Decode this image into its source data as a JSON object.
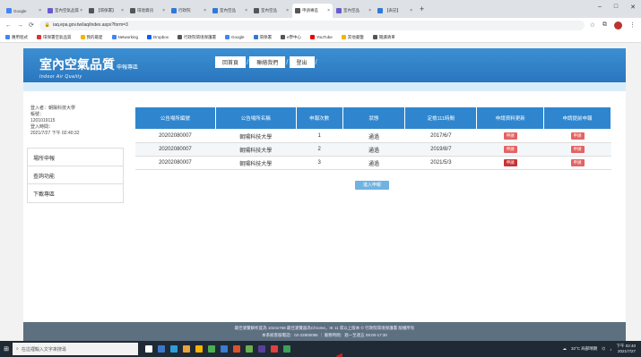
{
  "browser": {
    "tabs": [
      {
        "label": "Google",
        "color": "#4285f4",
        "active": false
      },
      {
        "label": "室內空氣品質",
        "color": "#6a5acd",
        "active": false
      },
      {
        "label": "【環保署】",
        "color": "#555555",
        "active": false
      },
      {
        "label": "環境資訊",
        "color": "#555555",
        "active": false
      },
      {
        "label": "行政院",
        "color": "#2f7ad6",
        "active": false
      },
      {
        "label": "室內空品",
        "color": "#2f7ad6",
        "active": false
      },
      {
        "label": "室內空品",
        "color": "#555555",
        "active": false
      },
      {
        "label": "申請專區",
        "color": "#555555",
        "active": true
      },
      {
        "label": "室內空品",
        "color": "#6a5acd",
        "active": false
      },
      {
        "label": "【表記】",
        "color": "#2f7ad6",
        "active": false
      }
    ],
    "new_tab": "+",
    "window_controls": [
      "–",
      "□",
      "✕"
    ],
    "url": "iaq.epa.gov.tw/iaq/index.aspx?form=3",
    "bookmarks": [
      {
        "label": "應用程式",
        "color": "#4285f4"
      },
      {
        "label": "環保署空氣品質",
        "color": "#d33"
      },
      {
        "label": "我的最愛",
        "color": "#f4b400"
      },
      {
        "label": "Networking",
        "color": "#4285f4"
      },
      {
        "label": "Dropbox",
        "color": "#0061ff"
      },
      {
        "label": "行政院環境保護署",
        "color": "#555"
      },
      {
        "label": "Google",
        "color": "#4285f4"
      },
      {
        "label": "環保署",
        "color": "#2f7ad6"
      },
      {
        "label": "e學中心",
        "color": "#555"
      },
      {
        "label": "YouTube",
        "color": "#e00"
      },
      {
        "label": "其他書籤",
        "color": "#f4b400"
      },
      {
        "label": "閱讀清單",
        "color": "#555"
      }
    ]
  },
  "site": {
    "title": "室內空氣品質",
    "title_suffix": "申報專區",
    "subtitle": "Indoor Air Quality",
    "nav": [
      "回首頁",
      "聯絡我們",
      "登出"
    ]
  },
  "sidebar": {
    "user_lines": [
      "登入者：朝陽科技大學",
      "帳號：",
      "1201019115",
      "登入時間：",
      "2021/7/27 下午 02:40:32"
    ],
    "menu": [
      "場所申報",
      "查詢功能",
      "下載專區"
    ]
  },
  "table": {
    "headers": [
      "公告場所編號",
      "公告場所名稱",
      "申報次數",
      "狀態",
      "定檢111時間",
      "申請資料更新",
      "申請提前申報"
    ],
    "rows": [
      {
        "id": "20202080007",
        "name": "朝陽科技大學",
        "count": "1",
        "status": "通過",
        "date": "2017/6/7",
        "update": "申請",
        "early": "申請"
      },
      {
        "id": "20202080007",
        "name": "朝陽科技大學",
        "count": "2",
        "status": "通過",
        "date": "2019/8/7",
        "update": "申請",
        "early": "申請"
      },
      {
        "id": "20202080007",
        "name": "朝陽科技大學",
        "count": "3",
        "status": "通過",
        "date": "2021/5/3",
        "update": "申請",
        "early": "申請"
      }
    ],
    "submit_label": "進入申報"
  },
  "footer": {
    "line1": "最佳瀏覽解析度為 1024x768 最佳瀏覽器為Chrome，IE 11 或以上版本 © 行政院環境保護署 版權所有",
    "line2": "本系統客服電話：02-22800095 ｜ 服務時間：週一至週五 09:00-17:30"
  },
  "taskbar": {
    "search_placeholder": "在這裡輸入文字來搜尋",
    "tray_temp": "32°C 局部晴朗",
    "time": "下午 02:40",
    "date": "2021/7/27",
    "app_colors": [
      "#ffffff",
      "#3c78c8",
      "#2d9cdb",
      "#e8a33d",
      "#f4b400",
      "#4caf50",
      "#3a7bd5",
      "#d9532c",
      "#6ab04c",
      "#5a3e9e",
      "#e04040",
      "#3ca05a"
    ]
  }
}
